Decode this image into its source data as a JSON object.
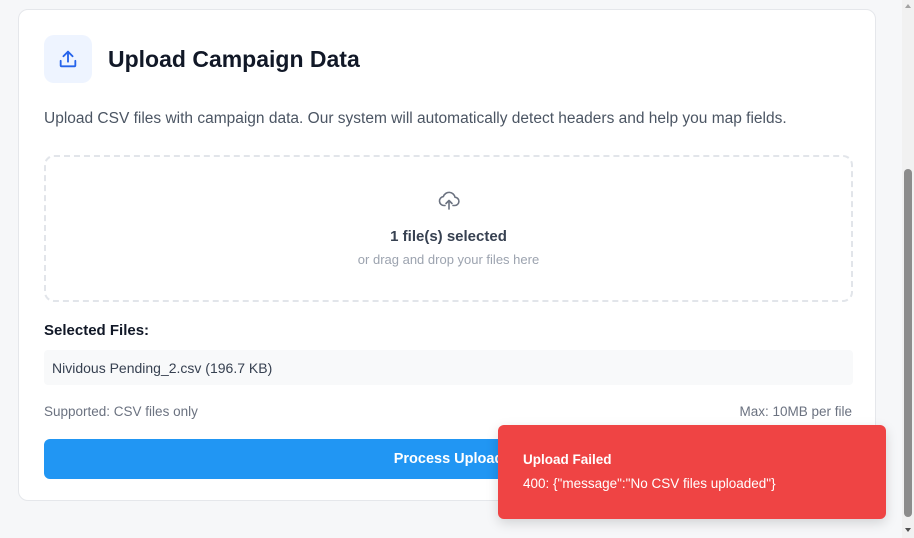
{
  "header": {
    "title": "Upload Campaign Data",
    "icon": "upload-icon",
    "accent_color": "#2563eb"
  },
  "description": "Upload CSV files with campaign data. Our system will automatically detect headers and help you map fields.",
  "dropzone": {
    "icon": "cloud-upload-icon",
    "primary_text": "1 file(s) selected",
    "secondary_text": "or drag and drop your files here"
  },
  "selected_files": {
    "label": "Selected Files:",
    "items": [
      {
        "name": "Nividous Pending_2.csv (196.7 KB)"
      }
    ]
  },
  "footer_info": {
    "supported": "Supported: CSV files only",
    "max_size": "Max: 10MB per file"
  },
  "process_button": {
    "label": "Process Upload",
    "color": "#2196f3"
  },
  "toast": {
    "title": "Upload Failed",
    "message": "400: {\"message\":\"No CSV files uploaded\"}",
    "color": "#ef4444"
  }
}
